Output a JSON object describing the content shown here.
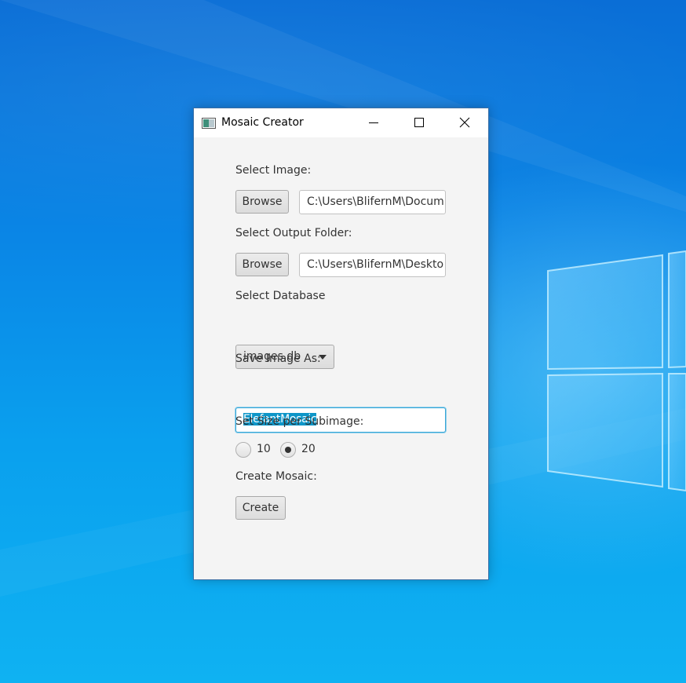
{
  "window": {
    "title": "Mosaic Creator",
    "controls": [
      "minimize",
      "maximize",
      "close"
    ]
  },
  "form": {
    "select_image_label": "Select Image:",
    "browse_image_label": "Browse",
    "image_path": "C:\\Users\\BlifernM\\Docum",
    "select_output_label": "Select Output Folder:",
    "browse_output_label": "Browse",
    "output_path": "C:\\Users\\BlifernM\\Deskto",
    "select_database_label": "Select Database",
    "database_selected": "images.db",
    "save_as_label": "Save Image As:",
    "save_as_value": "ElefantMosaic",
    "size_label": "Set Size per Subimage:",
    "size_options": [
      "10",
      "20"
    ],
    "size_selected": "20",
    "create_label": "Create Mosaic:",
    "create_button": "Create"
  },
  "colors": {
    "desktop": "#0a86e6",
    "selection": "#0e96c8",
    "focus_border": "#3aa6d6"
  }
}
